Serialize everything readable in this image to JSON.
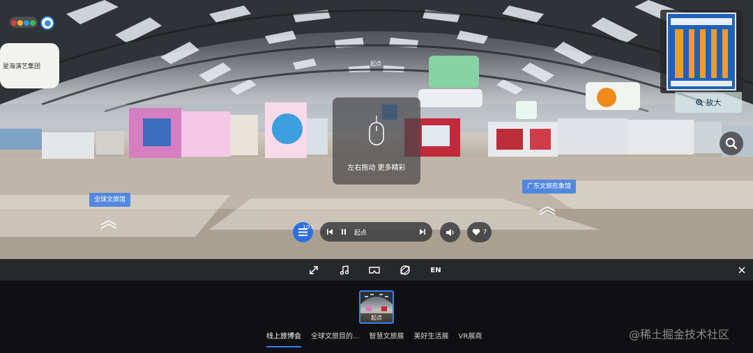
{
  "scene": {
    "left_sign_text": "星海演艺集团",
    "center_small_text": "起点"
  },
  "minimap": {
    "zoom_label": "放大"
  },
  "hint": {
    "text": "左右拖动 更多精彩"
  },
  "hotspots": {
    "left_label": "全球文旅馆",
    "right_label": "广东文旅形象馆"
  },
  "player": {
    "menu_count": "1/21",
    "current_scene": "起点",
    "like_count": "7"
  },
  "toolbar": {
    "lang_label": "EN",
    "icons": [
      "fullscreen-icon",
      "music-icon",
      "vr-icon",
      "gyro-icon",
      "close-icon"
    ]
  },
  "bottom": {
    "thumb_label": "起点",
    "tabs": [
      {
        "label": "线上旅博会",
        "active": true
      },
      {
        "label": "全球文旅目的...",
        "active": false
      },
      {
        "label": "智慧文旅展",
        "active": false
      },
      {
        "label": "美好生活展",
        "active": false
      },
      {
        "label": "VR展商",
        "active": false
      }
    ],
    "watermark": "@稀土掘金技术社区"
  },
  "colors": {
    "accent": "#2c6fe0",
    "toolbar_bg": "#27282b",
    "bottom_bg": "#101012"
  }
}
